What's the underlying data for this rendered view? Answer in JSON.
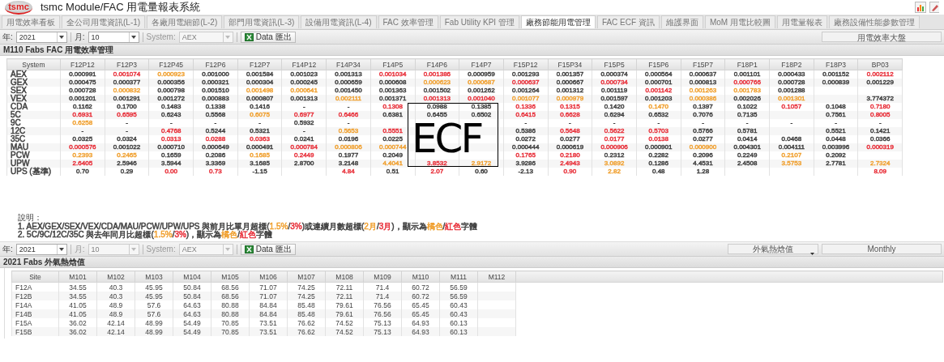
{
  "header": {
    "logo_text": "tsmc",
    "title": "tsmc Module/FAC 用電量報表系統"
  },
  "tabs": [
    {
      "label": "用電效率看板",
      "selected": false
    },
    {
      "label": "全公司用電資訊(L-1)",
      "selected": false
    },
    {
      "label": "各廠用電細節(L-2)",
      "selected": false
    },
    {
      "label": "部門用電資訊(L-3)",
      "selected": false
    },
    {
      "label": "設備用電資訊(L-4)",
      "selected": false
    },
    {
      "label": "FAC 效率管理",
      "selected": false
    },
    {
      "label": "Fab Utility KPI 管理",
      "selected": false
    },
    {
      "label": "廠務節能用電管理",
      "selected": true
    },
    {
      "label": "FAC ECF 資訊",
      "selected": false
    },
    {
      "label": "維護界面",
      "selected": false
    },
    {
      "label": "MoM 用電比較圖",
      "selected": false
    },
    {
      "label": "用電量報表",
      "selected": false
    },
    {
      "label": "廠務設備性能參數管理",
      "selected": false
    }
  ],
  "toolbar": {
    "fields": [
      {
        "label": "年:",
        "value": "2021",
        "disabled": false
      },
      {
        "label": "月:",
        "value": "10",
        "disabled": false
      },
      {
        "label": "System:",
        "value": "AEX",
        "disabled": true
      }
    ],
    "export_button": "Data 匯出",
    "right_button": "用電效率大盤"
  },
  "section_title": "M110 Fabs FAC 用電效率管理",
  "efficiency_table": {
    "columns": [
      "System",
      "F12P12",
      "F12P3",
      "F12P45",
      "F12P6",
      "F12P7",
      "F14P12",
      "F14P34",
      "F14P5",
      "F14P6",
      "F14P7",
      "F15P12",
      "F15P34",
      "F15P5",
      "F15P6",
      "F15P7",
      "F18P1",
      "F18P2",
      "F18P3",
      "BP03"
    ],
    "rows": [
      {
        "cells": [
          {
            "text": "AEX",
            "color": "#404040"
          },
          {
            "text": "0.000991",
            "color": "#404040"
          },
          {
            "text": "0.001074",
            "color": "#e8303a"
          },
          {
            "text": "0.000923",
            "color": "#f0a030"
          },
          {
            "text": "0.001000",
            "color": "#404040"
          },
          {
            "text": "0.001584",
            "color": "#404040"
          },
          {
            "text": "0.001023",
            "color": "#404040"
          },
          {
            "text": "0.001313",
            "color": "#404040"
          },
          {
            "text": "0.001034",
            "color": "#e8303a"
          },
          {
            "text": "0.001386",
            "color": "#e8303a"
          },
          {
            "text": "0.000959",
            "color": "#404040"
          },
          {
            "text": "0.001293",
            "color": "#404040"
          },
          {
            "text": "0.001357",
            "color": "#404040"
          },
          {
            "text": "0.000374",
            "color": "#404040"
          },
          {
            "text": "0.000564",
            "color": "#404040"
          },
          {
            "text": "0.000637",
            "color": "#404040"
          },
          {
            "text": "0.001101",
            "color": "#404040"
          },
          {
            "text": "0.000433",
            "color": "#404040"
          },
          {
            "text": "0.001152",
            "color": "#404040"
          },
          {
            "text": "0.002112",
            "color": "#e8303a"
          }
        ]
      },
      {
        "cells": [
          {
            "text": "GEX",
            "color": "#404040"
          },
          {
            "text": "0.000475",
            "color": "#404040"
          },
          {
            "text": "0.000377",
            "color": "#404040"
          },
          {
            "text": "0.000356",
            "color": "#404040"
          },
          {
            "text": "0.000321",
            "color": "#404040"
          },
          {
            "text": "0.000304",
            "color": "#404040"
          },
          {
            "text": "0.000245",
            "color": "#404040"
          },
          {
            "text": "0.000659",
            "color": "#404040"
          },
          {
            "text": "0.000608",
            "color": "#404040"
          },
          {
            "text": "0.000623",
            "color": "#f0a030"
          },
          {
            "text": "0.000687",
            "color": "#f0a030"
          },
          {
            "text": "0.000637",
            "color": "#e8303a"
          },
          {
            "text": "0.000667",
            "color": "#404040"
          },
          {
            "text": "0.000734",
            "color": "#e8303a"
          },
          {
            "text": "0.000701",
            "color": "#404040"
          },
          {
            "text": "0.000813",
            "color": "#404040"
          },
          {
            "text": "0.000766",
            "color": "#e8303a"
          },
          {
            "text": "0.000728",
            "color": "#404040"
          },
          {
            "text": "0.000839",
            "color": "#404040"
          },
          {
            "text": "0.001229",
            "color": "#404040"
          }
        ]
      },
      {
        "cells": [
          {
            "text": "SEX",
            "color": "#404040"
          },
          {
            "text": "0.000728",
            "color": "#404040"
          },
          {
            "text": "0.000832",
            "color": "#f0a030"
          },
          {
            "text": "0.000798",
            "color": "#404040"
          },
          {
            "text": "0.001510",
            "color": "#404040"
          },
          {
            "text": "0.001498",
            "color": "#f0a030"
          },
          {
            "text": "0.000641",
            "color": "#f0a030"
          },
          {
            "text": "0.001450",
            "color": "#404040"
          },
          {
            "text": "0.001363",
            "color": "#404040"
          },
          {
            "text": "0.001502",
            "color": "#404040"
          },
          {
            "text": "0.001262",
            "color": "#404040"
          },
          {
            "text": "0.001264",
            "color": "#404040"
          },
          {
            "text": "0.001312",
            "color": "#404040"
          },
          {
            "text": "0.001119",
            "color": "#404040"
          },
          {
            "text": "0.001142",
            "color": "#e8303a"
          },
          {
            "text": "0.001263",
            "color": "#f0a030"
          },
          {
            "text": "0.001783",
            "color": "#f0a030"
          },
          {
            "text": "0.001288",
            "color": "#404040"
          },
          null,
          null
        ]
      },
      {
        "cells": [
          {
            "text": "VEX",
            "color": "#404040"
          },
          {
            "text": "0.001201",
            "color": "#404040"
          },
          {
            "text": "0.001291",
            "color": "#404040"
          },
          {
            "text": "0.001272",
            "color": "#404040"
          },
          {
            "text": "0.000883",
            "color": "#404040"
          },
          {
            "text": "0.000807",
            "color": "#404040"
          },
          {
            "text": "0.001313",
            "color": "#404040"
          },
          {
            "text": "0.002111",
            "color": "#f0a030"
          },
          {
            "text": "0.001371",
            "color": "#404040"
          },
          {
            "text": "0.001313",
            "color": "#e8303a"
          },
          {
            "text": "0.001040",
            "color": "#e8303a"
          },
          {
            "text": "0.001077",
            "color": "#f0a030"
          },
          {
            "text": "0.000979",
            "color": "#f0a030"
          },
          {
            "text": "0.001597",
            "color": "#404040"
          },
          {
            "text": "0.001203",
            "color": "#404040"
          },
          {
            "text": "0.000386",
            "color": "#f0a030"
          },
          {
            "text": "0.002026",
            "color": "#404040"
          },
          {
            "text": "0.001301",
            "color": "#f0a030"
          },
          null,
          {
            "text": "3.774372",
            "color": "#404040"
          }
        ]
      },
      {
        "cells": [
          {
            "text": "CDA",
            "color": "#404040"
          },
          {
            "text": "0.1162",
            "color": "#404040"
          },
          {
            "text": "0.1700",
            "color": "#404040"
          },
          {
            "text": "0.1483",
            "color": "#404040"
          },
          {
            "text": "0.1338",
            "color": "#404040"
          },
          {
            "text": "0.1416",
            "color": "#404040"
          },
          {
            "text": "-"
          },
          {
            "text": "-"
          },
          {
            "text": "0.1308",
            "color": "#e8303a"
          },
          {
            "text": "0.0988",
            "color": "#404040"
          },
          {
            "text": "0.1385",
            "color": "#404040"
          },
          {
            "text": "0.1336",
            "color": "#e8303a"
          },
          {
            "text": "0.1315",
            "color": "#e8303a"
          },
          {
            "text": "0.1420",
            "color": "#404040"
          },
          {
            "text": "0.1470",
            "color": "#f0a030"
          },
          {
            "text": "0.1397",
            "color": "#404040"
          },
          {
            "text": "0.1022",
            "color": "#404040"
          },
          {
            "text": "0.1057",
            "color": "#e8303a"
          },
          {
            "text": "0.1048",
            "color": "#404040"
          },
          {
            "text": "0.7180",
            "color": "#e8303a"
          }
        ]
      },
      {
        "cells": [
          {
            "text": "5C",
            "color": "#404040"
          },
          {
            "text": "0.6931",
            "color": "#e8303a"
          },
          {
            "text": "0.6595",
            "color": "#e8303a"
          },
          {
            "text": "0.6243",
            "color": "#404040"
          },
          {
            "text": "0.5568",
            "color": "#404040"
          },
          {
            "text": "0.6075",
            "color": "#f0a030"
          },
          {
            "text": "0.6977",
            "color": "#e8303a"
          },
          {
            "text": "0.6466",
            "color": "#e8303a"
          },
          {
            "text": "0.6381",
            "color": "#404040"
          },
          {
            "text": "0.6455",
            "color": "#404040"
          },
          {
            "text": "0.6502",
            "color": "#404040"
          },
          {
            "text": "0.6415",
            "color": "#e8303a"
          },
          {
            "text": "0.6628",
            "color": "#e8303a"
          },
          {
            "text": "0.6294",
            "color": "#404040"
          },
          {
            "text": "0.6532",
            "color": "#404040"
          },
          {
            "text": "0.7076",
            "color": "#404040"
          },
          {
            "text": "0.7135",
            "color": "#404040"
          },
          null,
          {
            "text": "0.7561",
            "color": "#404040"
          },
          {
            "text": "0.8005",
            "color": "#e8303a"
          }
        ]
      },
      {
        "cells": [
          {
            "text": "9C",
            "color": "#404040"
          },
          {
            "text": "0.6258",
            "color": "#f0a030"
          },
          {
            "text": "-"
          },
          {
            "text": "-"
          },
          {
            "text": "-"
          },
          {
            "text": "-"
          },
          {
            "text": "0.5932",
            "color": "#404040"
          },
          {
            "text": "-"
          },
          null,
          null,
          null,
          {
            "text": "-"
          },
          {
            "text": "-"
          },
          {
            "text": "-"
          },
          {
            "text": "-"
          },
          {
            "text": "-"
          },
          {
            "text": "-"
          },
          {
            "text": "-"
          },
          {
            "text": "-"
          },
          {
            "text": "-"
          }
        ]
      },
      {
        "cells": [
          {
            "text": "12C",
            "color": "#404040"
          },
          {
            "text": "-"
          },
          {
            "text": "-"
          },
          {
            "text": "0.4768",
            "color": "#e8303a"
          },
          {
            "text": "0.5244",
            "color": "#404040"
          },
          {
            "text": "0.5321",
            "color": "#404040"
          },
          {
            "text": "-"
          },
          {
            "text": "0.5653",
            "color": "#f0a030"
          },
          {
            "text": "0.5551",
            "color": "#e8303a"
          },
          null,
          null,
          {
            "text": "0.5386",
            "color": "#404040"
          },
          {
            "text": "0.5648",
            "color": "#e8303a"
          },
          {
            "text": "0.5622",
            "color": "#e8303a"
          },
          {
            "text": "0.5703",
            "color": "#e8303a"
          },
          {
            "text": "0.5766",
            "color": "#404040"
          },
          {
            "text": "0.5781",
            "color": "#404040"
          },
          null,
          {
            "text": "0.5521",
            "color": "#404040"
          },
          {
            "text": "0.1421",
            "color": "#404040"
          }
        ]
      },
      {
        "cells": [
          {
            "text": "35C",
            "color": "#404040"
          },
          {
            "text": "0.0325",
            "color": "#404040"
          },
          {
            "text": "0.0324",
            "color": "#404040"
          },
          {
            "text": "0.0313",
            "color": "#e8303a"
          },
          {
            "text": "0.0288",
            "color": "#e8303a"
          },
          {
            "text": "0.0363",
            "color": "#e8303a"
          },
          {
            "text": "0.0241",
            "color": "#404040"
          },
          {
            "text": "0.0196",
            "color": "#404040"
          },
          {
            "text": "0.0225",
            "color": "#404040"
          },
          null,
          null,
          {
            "text": "0.0272",
            "color": "#404040"
          },
          {
            "text": "0.0277",
            "color": "#404040"
          },
          {
            "text": "0.0177",
            "color": "#e8303a"
          },
          {
            "text": "0.0138",
            "color": "#e8303a"
          },
          {
            "text": "0.0277",
            "color": "#404040"
          },
          {
            "text": "0.0414",
            "color": "#404040"
          },
          {
            "text": "0.0468",
            "color": "#404040"
          },
          {
            "text": "0.0448",
            "color": "#404040"
          },
          {
            "text": "0.0366",
            "color": "#404040"
          }
        ]
      },
      {
        "cells": [
          {
            "text": "MAU",
            "color": "#404040"
          },
          {
            "text": "0.000576",
            "color": "#e8303a"
          },
          {
            "text": "0.001022",
            "color": "#404040"
          },
          {
            "text": "0.000710",
            "color": "#404040"
          },
          {
            "text": "0.000649",
            "color": "#404040"
          },
          {
            "text": "0.000491",
            "color": "#404040"
          },
          {
            "text": "0.000784",
            "color": "#e8303a"
          },
          {
            "text": "0.000806",
            "color": "#f0a030"
          },
          {
            "text": "0.000744",
            "color": "#f0a030"
          },
          null,
          null,
          {
            "text": "0.000444",
            "color": "#404040"
          },
          {
            "text": "0.000619",
            "color": "#404040"
          },
          {
            "text": "0.000906",
            "color": "#e8303a"
          },
          {
            "text": "0.000901",
            "color": "#404040"
          },
          {
            "text": "0.000900",
            "color": "#f0a030"
          },
          {
            "text": "0.004301",
            "color": "#404040"
          },
          {
            "text": "0.004111",
            "color": "#404040"
          },
          {
            "text": "0.003996",
            "color": "#404040"
          },
          {
            "text": "0.000319",
            "color": "#e8303a"
          }
        ]
      },
      {
        "cells": [
          {
            "text": "PCW",
            "color": "#404040"
          },
          {
            "text": "0.2393",
            "color": "#f0a030"
          },
          {
            "text": "0.2465",
            "color": "#f0a030"
          },
          {
            "text": "0.1659",
            "color": "#404040"
          },
          {
            "text": "0.2086",
            "color": "#404040"
          },
          {
            "text": "0.1685",
            "color": "#f0a030"
          },
          {
            "text": "0.2449",
            "color": "#e8303a"
          },
          {
            "text": "0.1977",
            "color": "#404040"
          },
          {
            "text": "0.2049",
            "color": "#404040"
          },
          null,
          null,
          {
            "text": "0.1765",
            "color": "#e8303a"
          },
          {
            "text": "0.2180",
            "color": "#e8303a"
          },
          {
            "text": "0.2312",
            "color": "#404040"
          },
          {
            "text": "0.2282",
            "color": "#404040"
          },
          {
            "text": "0.2096",
            "color": "#404040"
          },
          {
            "text": "0.2249",
            "color": "#404040"
          },
          {
            "text": "0.2107",
            "color": "#f0a030"
          },
          {
            "text": "0.2092",
            "color": "#404040"
          },
          null
        ]
      },
      {
        "cells": [
          {
            "text": "UPW",
            "color": "#404040"
          },
          {
            "text": "2.6405",
            "color": "#e8303a"
          },
          {
            "text": "2.5946",
            "color": "#404040"
          },
          {
            "text": "3.5944",
            "color": "#404040"
          },
          {
            "text": "3.3369",
            "color": "#404040"
          },
          {
            "text": "3.1685",
            "color": "#404040"
          },
          {
            "text": "2.8700",
            "color": "#404040"
          },
          {
            "text": "3.2148",
            "color": "#404040"
          },
          {
            "text": "4.4041",
            "color": "#f0a030"
          },
          {
            "text": "3.8532",
            "color": "#e8303a"
          },
          {
            "text": "2.9172",
            "color": "#f0a030"
          },
          {
            "text": "3.9286",
            "color": "#404040"
          },
          {
            "text": "2.4943",
            "color": "#e8303a"
          },
          {
            "text": "3.0892",
            "color": "#f0a030"
          },
          {
            "text": "0.1286",
            "color": "#404040"
          },
          {
            "text": "4.4531",
            "color": "#404040"
          },
          {
            "text": "2.4508",
            "color": "#404040"
          },
          {
            "text": "3.5753",
            "color": "#f0a030"
          },
          {
            "text": "2.7781",
            "color": "#404040"
          },
          {
            "text": "2.7324",
            "color": "#f0a030"
          }
        ]
      },
      {
        "cells": [
          {
            "text": "UPS (基準)",
            "color": "#404040"
          },
          {
            "text": "0.70",
            "color": "#404040"
          },
          {
            "text": "0.29",
            "color": "#404040"
          },
          {
            "text": "0.00",
            "color": "#e8303a"
          },
          {
            "text": "0.73",
            "color": "#e8303a"
          },
          {
            "text": "-1.15",
            "color": "#404040"
          },
          null,
          {
            "text": "4.84",
            "color": "#e8303a"
          },
          {
            "text": "0.51",
            "color": "#404040"
          },
          {
            "text": "2.07",
            "color": "#e8303a"
          },
          {
            "text": "0.60",
            "color": "#404040"
          },
          {
            "text": "-2.13",
            "color": "#404040"
          },
          {
            "text": "0.90",
            "color": "#e8303a"
          },
          {
            "text": "2.82",
            "color": "#f0a030"
          },
          {
            "text": "0.48",
            "color": "#404040"
          },
          {
            "text": "1.28",
            "color": "#404040"
          },
          null,
          null,
          null,
          {
            "text": "8.09",
            "color": "#e8303a"
          }
        ]
      }
    ]
  },
  "overlay_label": {
    "text": "ECF"
  },
  "notes": {
    "title": "說明：",
    "lines": [
      [
        {
          "text": "1. AEX/GEX/SEX/VEX/CDA/MAU/PCW/UPW/UPS 與前月比單月超標(",
          "color": "#404040"
        },
        {
          "text": "1.5%",
          "color": "#f0a030"
        },
        {
          "text": "/"
        },
        {
          "text": "3%",
          "color": "#e8303a"
        },
        {
          "text": ")或連續月數超標(",
          "color": "#404040"
        },
        {
          "text": "2月",
          "color": "#f0a030"
        },
        {
          "text": "/"
        },
        {
          "text": "3月",
          "color": "#e8303a"
        },
        {
          "text": ")，顯示為",
          "color": "#404040"
        },
        {
          "text": "橘色",
          "color": "#f0a030"
        },
        {
          "text": "/"
        },
        {
          "text": "紅色",
          "color": "#e8303a"
        },
        {
          "text": "字體",
          "color": "#404040"
        }
      ],
      [
        {
          "text": "2. 5C/9C/12C/35C 與去年同月比超標(",
          "color": "#404040"
        },
        {
          "text": "1.5%",
          "color": "#f0a030"
        },
        {
          "text": "/"
        },
        {
          "text": "3%",
          "color": "#e8303a"
        },
        {
          "text": ")，顯示為",
          "color": "#404040"
        },
        {
          "text": "橘色",
          "color": "#f0a030"
        },
        {
          "text": "/"
        },
        {
          "text": "紅色",
          "color": "#e8303a"
        },
        {
          "text": "字體",
          "color": "#404040"
        }
      ]
    ]
  },
  "bottom_toolbar": {
    "fields": [
      {
        "label": "年:",
        "value": "2021",
        "disabled": false
      },
      {
        "label": "月:",
        "value": "10",
        "disabled": true
      },
      {
        "label": "System:",
        "value": "AEX",
        "disabled": true
      }
    ],
    "export_button": "Data 匯出",
    "dropdown": "外氣熱焓值",
    "right_button": "Monthly"
  },
  "bottom_title": "2021 Fabs 外氣熱焓值",
  "enthalpy_table": {
    "columns": [
      "Site",
      "M101",
      "M102",
      "M103",
      "M104",
      "M105",
      "M106",
      "M107",
      "M108",
      "M109",
      "M110",
      "M111",
      "M112"
    ],
    "rows": [
      {
        "cells": [
          "F12A",
          "34.55",
          "40.3",
          "45.95",
          "50.84",
          "68.56",
          "71.07",
          "74.25",
          "72.11",
          "71.4",
          "60.72",
          "56.59"
        ]
      },
      {
        "cells": [
          "F12B",
          "34.55",
          "40.3",
          "45.95",
          "50.84",
          "68.56",
          "71.07",
          "74.25",
          "72.11",
          "71.4",
          "60.72",
          "56.59"
        ]
      },
      {
        "cells": [
          "F14A",
          "41.05",
          "48.9",
          "57.6",
          "64.63",
          "80.88",
          "84.84",
          "85.48",
          "79.61",
          "76.56",
          "65.45",
          "60.43"
        ]
      },
      {
        "cells": [
          "F14B",
          "41.05",
          "48.9",
          "57.6",
          "64.63",
          "80.88",
          "84.84",
          "85.48",
          "79.61",
          "76.56",
          "65.45",
          "60.43"
        ]
      },
      {
        "cells": [
          "F15A",
          "36.02",
          "42.14",
          "48.99",
          "54.49",
          "70.85",
          "73.51",
          "76.62",
          "74.52",
          "75.13",
          "64.93",
          "60.13"
        ]
      },
      {
        "cells": [
          "F15B",
          "36.02",
          "42.14",
          "48.99",
          "54.49",
          "70.85",
          "73.51",
          "76.62",
          "74.52",
          "75.13",
          "64.93",
          "60.13"
        ]
      }
    ]
  }
}
